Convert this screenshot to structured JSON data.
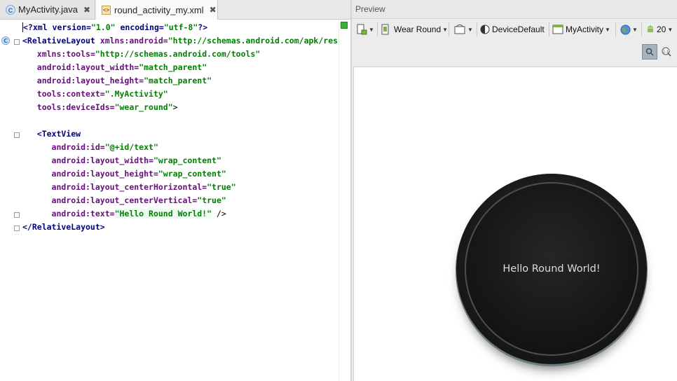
{
  "editor": {
    "tabs": [
      {
        "label": "MyActivity.java",
        "icon": "class-c-icon"
      },
      {
        "label": "round_activity_my.xml",
        "icon": "xml-file-icon"
      }
    ],
    "code": {
      "l1": {
        "a": "<?xml version=",
        "b": "\"1.0\"",
        "c": " encoding=",
        "d": "\"utf-8\"",
        "e": "?>"
      },
      "l2": {
        "a": "<RelativeLayout ",
        "b": "xmlns:android=",
        "c": "\"http://schemas.android.com/apk/res"
      },
      "l3": {
        "a": "xmlns:tools=",
        "b": "\"http://schemas.android.com/tools\""
      },
      "l4": {
        "a": "android:layout_width=",
        "b": "\"match_parent\""
      },
      "l5": {
        "a": "android:layout_height=",
        "b": "\"match_parent\""
      },
      "l6": {
        "a": "tools:context=",
        "b": "\".MyActivity\""
      },
      "l7": {
        "a": "tools:deviceIds=",
        "b": "\"wear_round\"",
        "c": ">"
      },
      "l9": {
        "a": "<TextView"
      },
      "l10": {
        "a": "android:id=",
        "b": "\"@+id/text\""
      },
      "l11": {
        "a": "android:layout_width=",
        "b": "\"wrap_content\""
      },
      "l12": {
        "a": "android:layout_height=",
        "b": "\"wrap_content\""
      },
      "l13": {
        "a": "android:layout_centerHorizontal=",
        "b": "\"true\""
      },
      "l14": {
        "a": "android:layout_centerVertical=",
        "b": "\"true\""
      },
      "l15": {
        "a": "android:text=",
        "b": "\"Hello Round World!\"",
        "c": " />"
      },
      "l16": {
        "a": "</RelativeLayout>"
      }
    }
  },
  "preview": {
    "title": "Preview",
    "toolbar": {
      "device": "Wear Round",
      "theme": "DeviceDefault",
      "activity": "MyActivity",
      "api": "20"
    },
    "watch_text": "Hello Round World!"
  }
}
